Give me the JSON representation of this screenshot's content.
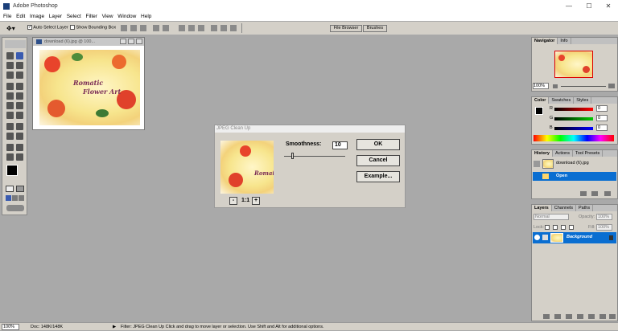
{
  "window": {
    "title": "Adobe Photoshop",
    "min": "—",
    "max": "☐",
    "close": "✕"
  },
  "menu": [
    "File",
    "Edit",
    "Image",
    "Layer",
    "Select",
    "Filter",
    "View",
    "Window",
    "Help"
  ],
  "options": {
    "auto_select": "Auto Select Layer",
    "show_bbox": "Show Bounding Box",
    "tab_file_browser": "File Browser",
    "tab_brushes": "Brushes"
  },
  "document": {
    "title": "download (6).jpg @ 100...",
    "art_title1": "Romatic",
    "art_title2": "Flower Art"
  },
  "dialog": {
    "title": "JPEG Clean Up",
    "smoothness_label": "Smoothness:",
    "smoothness_value": "10",
    "ok": "OK",
    "cancel": "Cancel",
    "example": "Example...",
    "zoom": "1:1",
    "zoom_out": "-",
    "zoom_in": "+"
  },
  "navigator": {
    "tabs": [
      "Navigator",
      "Info"
    ],
    "zoom": "100%"
  },
  "color": {
    "tabs": [
      "Color",
      "Swatches",
      "Styles"
    ],
    "channels": [
      {
        "label": "R",
        "value": "0",
        "color": "#cc0000"
      },
      {
        "label": "G",
        "value": "0",
        "color": "#00aa00"
      },
      {
        "label": "B",
        "value": "0",
        "color": "#0000cc"
      }
    ]
  },
  "history": {
    "tabs": [
      "History",
      "Actions",
      "Tool Presets"
    ],
    "items": [
      "download (6).jpg",
      "Open"
    ]
  },
  "layers": {
    "tabs": [
      "Layers",
      "Channels",
      "Paths"
    ],
    "blend_mode": "Normal",
    "opacity_label": "Opacity:",
    "opacity": "100%",
    "lock_label": "Lock:",
    "fill_label": "Fill:",
    "fill": "100%",
    "layer_name": "Background"
  },
  "status": {
    "zoom": "100%",
    "doc": "Doc: 148K/148K",
    "info": "Filter: JPEG Clean Up  Click and drag to move layer or selection. Use Shift and Alt for additional options."
  }
}
